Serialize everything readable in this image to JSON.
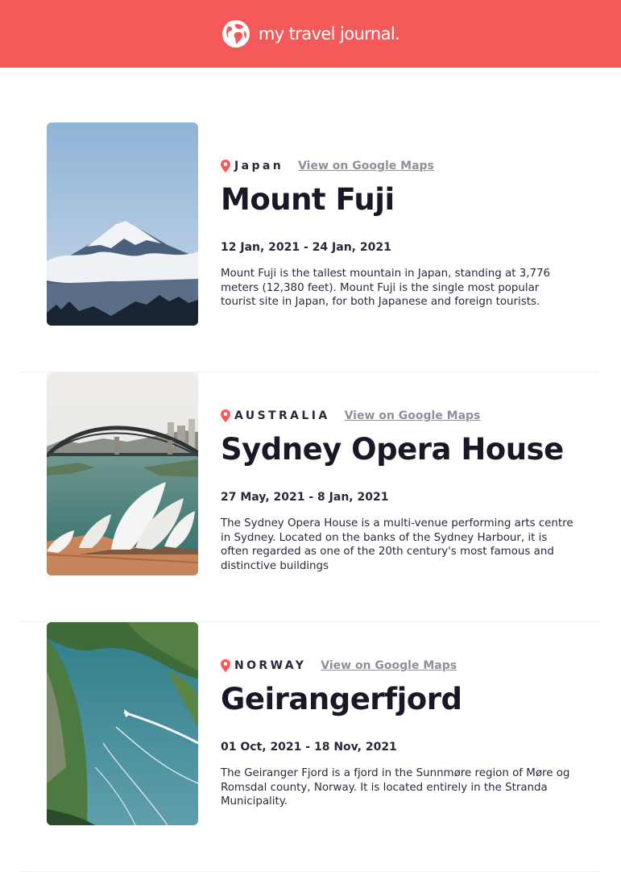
{
  "header": {
    "brand": "my travel journal."
  },
  "colors": {
    "header_bg": "#f55a5a",
    "pin": "#f55a5a",
    "link": "#918e9b"
  },
  "entries": [
    {
      "country": "Japan",
      "maps_label": "View on Google Maps",
      "title": "Mount Fuji",
      "dates": "12 Jan, 2021 - 24 Jan, 2021",
      "description": "Mount Fuji is the tallest mountain in Japan, standing at 3,776 meters (12,380 feet). Mount Fuji is the single most popular tourist site in Japan, for both Japanese and foreign tourists."
    },
    {
      "country": "AUSTRALIA",
      "maps_label": "View on Google Maps",
      "title": "Sydney Opera House",
      "dates": "27 May, 2021 - 8 Jan, 2021",
      "description": "The Sydney Opera House is a multi-venue performing arts centre in Sydney. Located on the banks of the Sydney Harbour, it is often regarded as one of the 20th century's most famous and distinctive buildings"
    },
    {
      "country": "NORWAY",
      "maps_label": "View on Google Maps",
      "title": "Geirangerfjord",
      "dates": "01 Oct, 2021 - 18 Nov, 2021",
      "description": "The Geiranger Fjord is a fjord in the Sunnmøre region of Møre og Romsdal county, Norway. It is located entirely in the Stranda Municipality."
    }
  ]
}
